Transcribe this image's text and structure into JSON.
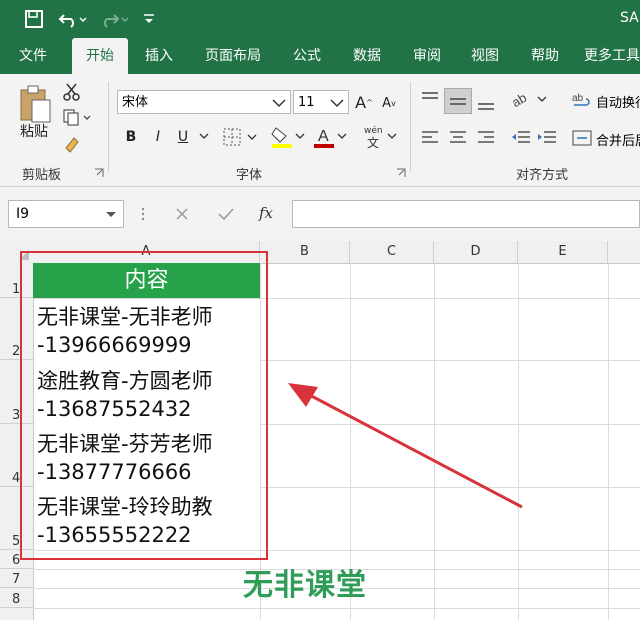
{
  "titlebar": {
    "save_icon": "save-icon",
    "undo_icon": "undo-icon",
    "redo_icon": "redo-icon",
    "doc_name": "SA"
  },
  "tabs": [
    {
      "label": "文件",
      "active": false
    },
    {
      "label": "开始",
      "active": true
    },
    {
      "label": "插入",
      "active": false
    },
    {
      "label": "页面布局",
      "active": false
    },
    {
      "label": "公式",
      "active": false
    },
    {
      "label": "数据",
      "active": false
    },
    {
      "label": "审阅",
      "active": false
    },
    {
      "label": "视图",
      "active": false
    },
    {
      "label": "帮助",
      "active": false
    },
    {
      "label": "更多工具",
      "active": false
    }
  ],
  "ribbon": {
    "clipboard": {
      "paste_label": "粘贴",
      "group_label": "剪贴板"
    },
    "font": {
      "font_name": "宋体",
      "font_size": "11",
      "bold": "B",
      "italic": "I",
      "underline": "U",
      "group_label": "字体",
      "phonetic": "wén\n文"
    },
    "align": {
      "wrap_text": "自动换行",
      "merge_center": "合并后居中",
      "group_label": "对齐方式"
    }
  },
  "formula_bar": {
    "name_box": "I9",
    "fx_label": "fx",
    "value": ""
  },
  "columns": [
    "A",
    "B",
    "C",
    "D",
    "E"
  ],
  "rows": [
    "1",
    "2",
    "3",
    "4",
    "5",
    "6",
    "7",
    "8"
  ],
  "cells": {
    "header": "内容",
    "lines": [
      "无非课堂-无非老师",
      "-13966669999",
      "途胜教育-方圆老师",
      "-13687552432",
      "无非课堂-芬芳老师",
      "-13877776666",
      "无非课堂-玲玲助教",
      "-13655552222"
    ]
  },
  "watermark": "无非课堂",
  "colors": {
    "excel_green": "#217346",
    "header_fill": "#27a24a",
    "annotation_red": "#d8333b"
  }
}
